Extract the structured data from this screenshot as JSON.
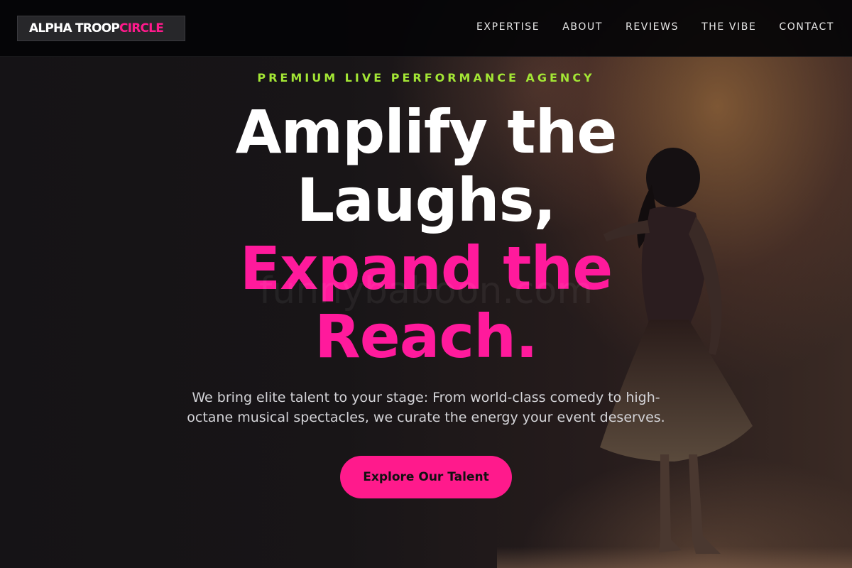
{
  "brand": {
    "logo_white": "ALPHA TROOP",
    "logo_pink": "CIRCLE"
  },
  "nav": {
    "items": [
      {
        "label": "EXPERTISE"
      },
      {
        "label": "ABOUT"
      },
      {
        "label": "REVIEWS"
      },
      {
        "label": "THE VIBE"
      },
      {
        "label": "CONTACT"
      }
    ]
  },
  "hero": {
    "eyebrow": "PREMIUM LIVE PERFORMANCE AGENCY",
    "headline_line1": "Amplify the",
    "headline_line2": "Laughs,",
    "headline_line3": "Expand the",
    "headline_line4": "Reach.",
    "subtitle": "We bring elite talent to your stage: From world-class comedy to high-octane musical spectacles, we curate the energy your event deserves.",
    "cta_label": "Explore Our Talent",
    "watermark": "funnybaboon.com"
  },
  "colors": {
    "accent_pink": "#ff1a8c",
    "accent_green": "#a3e635",
    "header_bg": "#040406"
  }
}
